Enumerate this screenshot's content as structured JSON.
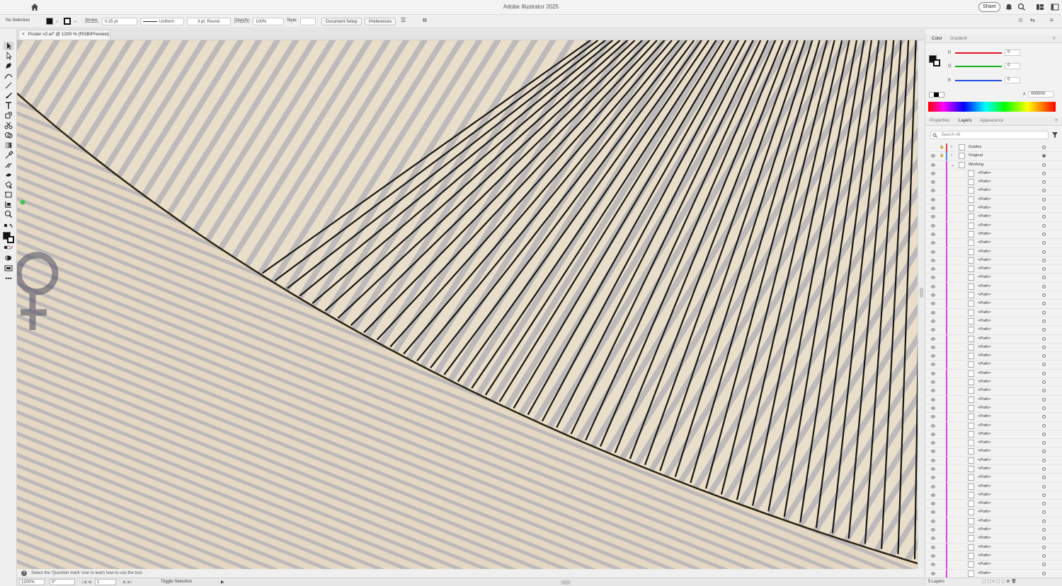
{
  "app": {
    "title": "Adobe Illustrator 2025",
    "share_label": "Share"
  },
  "control_bar": {
    "selection_label": "No Selection",
    "stroke_label": "Stroke:",
    "stroke_weight": "0.25 pt",
    "profile": "Uniform",
    "brush": "3 pt. Round",
    "opacity_label": "Opacity:",
    "opacity_value": "100%",
    "style_label": "Style:",
    "document_setup_label": "Document Setup",
    "preferences_label": "Preferences"
  },
  "document_tab": {
    "label": "Poster v2.ai* @ 1200 % (RGB/Preview)"
  },
  "status": {
    "hint": "Select the 'Question mark' icon to learn how to use the tool.",
    "zoom": "1200%",
    "rotation": "0°",
    "artboard": "1",
    "toggle_selection": "Toggle Selection"
  },
  "color_panel": {
    "tabs": [
      "Color",
      "Gradient"
    ],
    "channels": [
      {
        "label": "R",
        "value": "0",
        "color": "#e0141e"
      },
      {
        "label": "G",
        "value": "0",
        "color": "#18b018"
      },
      {
        "label": "B",
        "value": "0",
        "color": "#2050e0"
      }
    ],
    "hex_label": "#",
    "hex_value": "000000"
  },
  "layers_panel": {
    "tabs": [
      "Properties",
      "Layers",
      "Appearance"
    ],
    "search_placeholder": "Search All",
    "layers": [
      {
        "name": "Guides",
        "color": "#e04848"
      },
      {
        "name": "Original",
        "color": "#4a8fe0"
      },
      {
        "name": "Working",
        "color": "#e040e0"
      }
    ],
    "sublayer_name": "<Path>",
    "sublayer_count": 47,
    "footer": "5 Layers"
  },
  "colors": {
    "canvas_bg": "#e8dcc7",
    "selection_layer_color": "#e040e0"
  }
}
